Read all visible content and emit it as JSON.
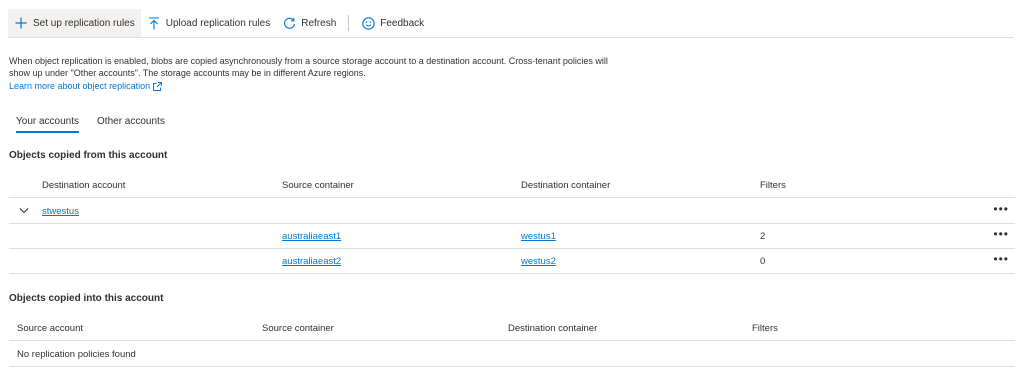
{
  "toolbar": {
    "setup_label": "Set up replication rules",
    "upload_label": "Upload replication rules",
    "refresh_label": "Refresh",
    "feedback_label": "Feedback"
  },
  "info": {
    "text": "When object replication is enabled, blobs are copied asynchronously from a source storage account to a destination account. Cross-tenant policies will show up under \"Other accounts\". The storage accounts may be in different Azure regions.",
    "learn_more": "Learn more about object replication"
  },
  "tabs": [
    {
      "label": "Your accounts",
      "selected": true
    },
    {
      "label": "Other accounts",
      "selected": false
    }
  ],
  "copied_from": {
    "title": "Objects copied from this account",
    "headers": [
      "Destination account",
      "Source container",
      "Destination container",
      "Filters"
    ],
    "group": {
      "account": "stwestus"
    },
    "rows": [
      {
        "source": "australiaeast1",
        "destination": "westus1",
        "filters": "2"
      },
      {
        "source": "australiaeast2",
        "destination": "westus2",
        "filters": "0"
      }
    ],
    "more_glyph": "•••"
  },
  "copied_into": {
    "title": "Objects copied into this account",
    "headers": [
      "Source account",
      "Source container",
      "Destination container",
      "Filters"
    ],
    "empty_text": "No replication policies found"
  },
  "colors": {
    "accent": "#0078d4",
    "text": "#323130",
    "divider": "#e1dfdd"
  }
}
